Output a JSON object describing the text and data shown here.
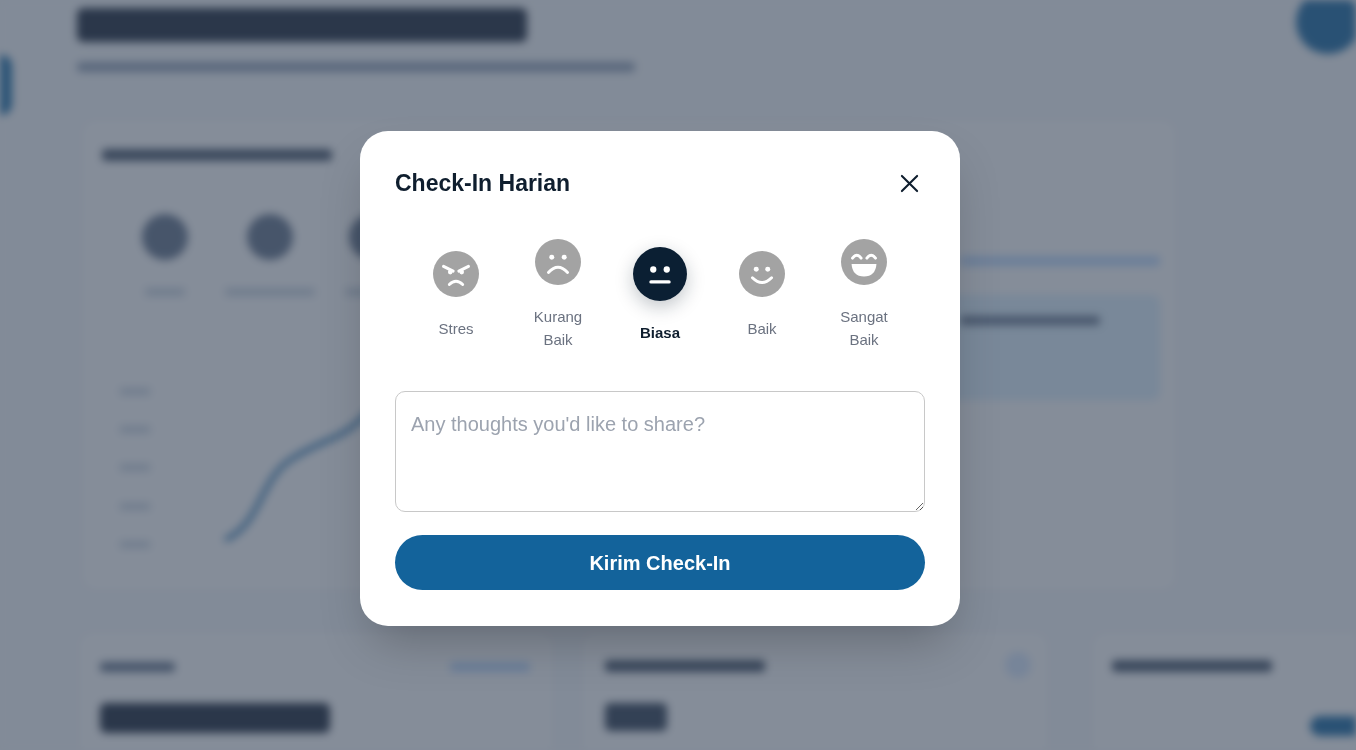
{
  "page_behind": {
    "blurred": true
  },
  "dialog": {
    "title": "Check-In Harian",
    "moods": [
      {
        "label": "Stres",
        "kind": "angry",
        "selected": false
      },
      {
        "label": "Kurang Baik",
        "kind": "sad",
        "selected": false
      },
      {
        "label": "Biasa",
        "kind": "neutral",
        "selected": true
      },
      {
        "label": "Baik",
        "kind": "smile",
        "selected": false
      },
      {
        "label": "Sangat Baik",
        "kind": "grin",
        "selected": false
      }
    ],
    "note": {
      "placeholder": "Any thoughts you'd like to share?"
    },
    "submit_button": "Kirim Check-In"
  }
}
